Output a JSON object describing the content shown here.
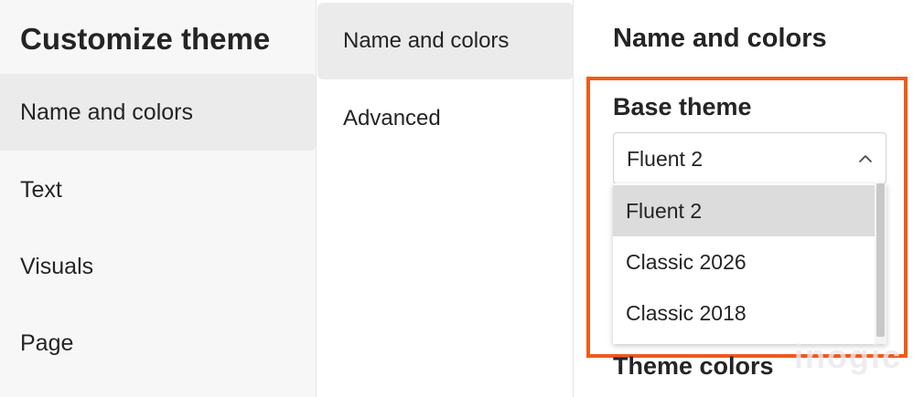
{
  "left_nav": {
    "title": "Customize theme",
    "items": [
      {
        "label": "Name and colors",
        "selected": true
      },
      {
        "label": "Text",
        "selected": false
      },
      {
        "label": "Visuals",
        "selected": false
      },
      {
        "label": "Page",
        "selected": false
      }
    ]
  },
  "mid_nav": {
    "items": [
      {
        "label": "Name and colors",
        "selected": true
      },
      {
        "label": "Advanced",
        "selected": false
      }
    ]
  },
  "panel": {
    "title": "Name and colors",
    "base_theme": {
      "label": "Base theme",
      "value": "Fluent 2",
      "options": [
        {
          "label": "Fluent 2",
          "selected": true
        },
        {
          "label": "Classic 2026",
          "selected": false
        },
        {
          "label": "Classic 2018",
          "selected": false
        }
      ]
    },
    "theme_colors_label": "Theme colors"
  },
  "watermark": "inogic",
  "colors": {
    "highlight_border": "#f05a1a",
    "selected_bg": "#ebebeb",
    "option_selected_bg": "#dcdcdc"
  },
  "icons": {
    "select_chevron": "chevron-up-icon"
  }
}
